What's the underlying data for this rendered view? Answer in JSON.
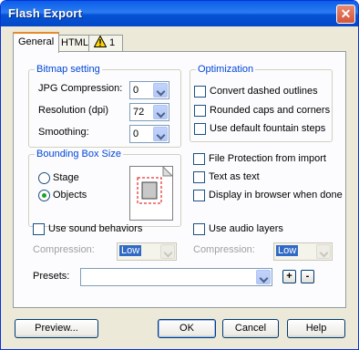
{
  "window": {
    "title": "Flash Export"
  },
  "tabs": [
    {
      "label": "General"
    },
    {
      "label": "HTML"
    },
    {
      "label": "1 issue"
    }
  ],
  "bitmap": {
    "title": "Bitmap setting",
    "jpg_label": "JPG Compression:",
    "jpg_value": "0",
    "resolution_label": "Resolution (dpi)",
    "resolution_value": "72",
    "smoothing_label": "Smoothing:",
    "smoothing_value": "0"
  },
  "optimization": {
    "title": "Optimization",
    "convert_dashed": "Convert dashed outlines",
    "rounded_caps": "Rounded caps and corners",
    "default_fountain": "Use default fountain steps"
  },
  "bbox": {
    "title": "Bounding Box Size",
    "stage": "Stage",
    "objects": "Objects"
  },
  "options": {
    "file_protection": "File Protection from import",
    "text_as_text": "Text as text",
    "display_in_browser": "Display in browser when done"
  },
  "sound": {
    "use_sound": "Use sound behaviors",
    "compression_label": "Compression:",
    "compression_value": "Low"
  },
  "audio": {
    "use_audio": "Use audio layers",
    "compression_label": "Compression:",
    "compression_value": "Low"
  },
  "presets": {
    "label": "Presets:",
    "value": ""
  },
  "buttons": {
    "add": "+",
    "remove": "-",
    "preview": "Preview...",
    "ok": "OK",
    "cancel": "Cancel",
    "help": "Help"
  }
}
